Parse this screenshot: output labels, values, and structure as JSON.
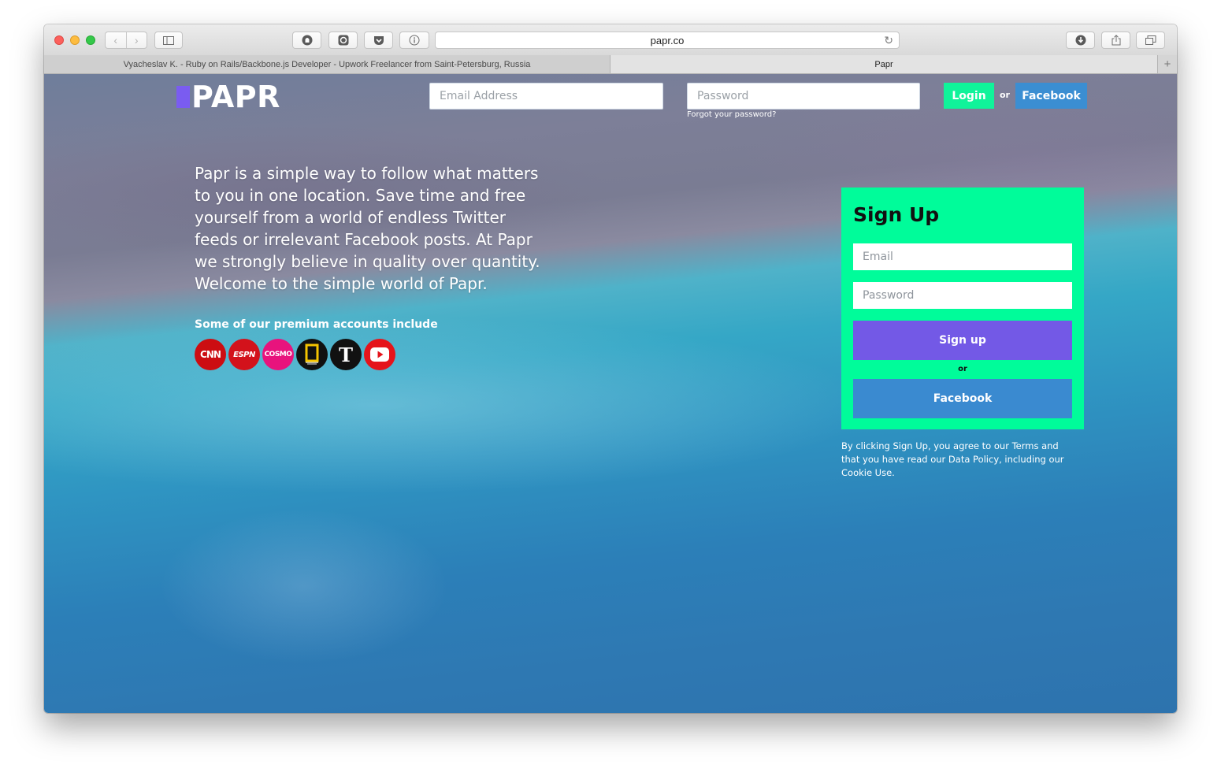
{
  "browser": {
    "url": "papr.co",
    "tabs": [
      {
        "label": "Vyacheslav K. - Ruby on Rails/Backbone.js Developer - Upwork Freelancer from Saint-Petersburg, Russia"
      },
      {
        "label": "Papr"
      }
    ],
    "new_tab_symbol": "+"
  },
  "header": {
    "logo_text": "PAPR",
    "email_placeholder": "Email Address",
    "password_placeholder": "Password",
    "forgot_password": "Forgot your password?",
    "login_label": "Login",
    "or_label": "or",
    "facebook_label": "Facebook"
  },
  "intro": {
    "text": "Papr is a simple way to follow what matters to you in one location. Save time and free yourself from a world of endless Twitter feeds or irrelevant Facebook posts. At Papr we strongly believe in quality over quantity. Welcome to the simple world of Papr.",
    "premium_label": "Some of our premium accounts include",
    "brands": [
      {
        "name": "CNN",
        "label": "CNN"
      },
      {
        "name": "ESPN",
        "label": "ESPN"
      },
      {
        "name": "Cosmo",
        "label": "COSMO"
      },
      {
        "name": "National Geographic",
        "label": ""
      },
      {
        "name": "The New York Times",
        "label": "T"
      },
      {
        "name": "YouTube",
        "label": ""
      }
    ]
  },
  "signup": {
    "title": "Sign Up",
    "email_placeholder": "Email",
    "password_placeholder": "Password",
    "signup_label": "Sign up",
    "or_label": "or",
    "facebook_label": "Facebook",
    "terms": "By clicking Sign Up, you agree to our Terms and that you have read our Data Policy, including our Cookie Use."
  },
  "icons": {
    "back": "chevron-left-icon",
    "forward": "chevron-right-icon",
    "sidebar": "sidebar-icon",
    "reload": "reload-icon",
    "download": "download-icon",
    "share": "share-icon",
    "tabs": "tabs-icon"
  },
  "colors": {
    "accent_green": "#00fc9a",
    "login_green": "#10f39a",
    "signup_purple": "#7359e6",
    "facebook_blue": "#3a8ad0",
    "logo_purple": "#7a5cf0"
  }
}
